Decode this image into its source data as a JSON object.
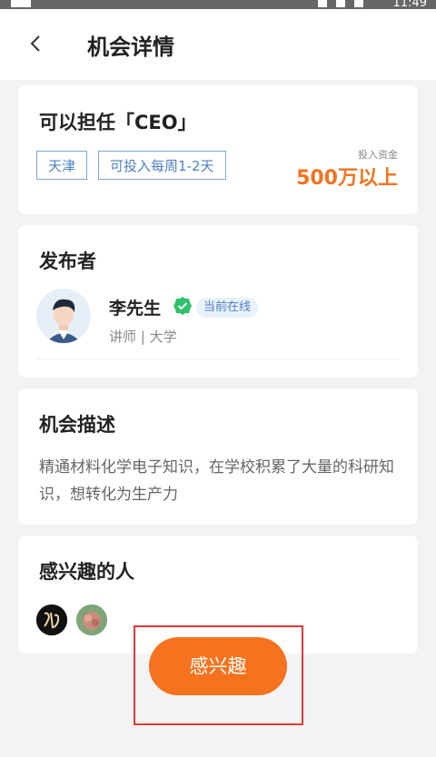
{
  "status_bar": {
    "time": "11:49"
  },
  "header": {
    "title": "机会详情"
  },
  "opportunity": {
    "title": "可以担任「CEO」",
    "tags": [
      "天津",
      "可投入每周1-2天"
    ],
    "investment_label": "投入资金",
    "investment_value": "500万以上"
  },
  "publisher": {
    "section_title": "发布者",
    "name": "李先生",
    "online_status": "当前在线",
    "meta": "讲师 | 大学"
  },
  "description": {
    "section_title": "机会描述",
    "text": "精通材料化学电子知识，在学校积累了大量的科研知识，想转化为生产力"
  },
  "interested": {
    "section_title": "感兴趣的人"
  },
  "cta": {
    "label": "感兴趣"
  },
  "colors": {
    "accent": "#f5731e",
    "tag_blue": "#4d7fc2",
    "verify_green": "#2ec26a",
    "highlight": "#e53935"
  }
}
